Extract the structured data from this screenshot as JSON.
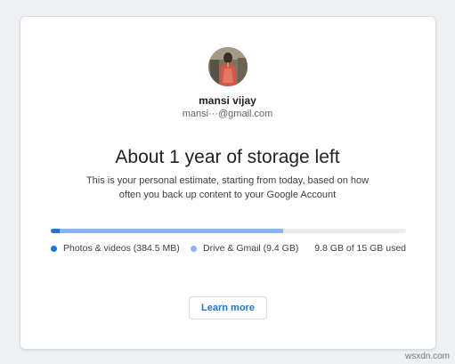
{
  "account": {
    "name": "mansi vijay",
    "email": "mansi···@gmail.com"
  },
  "estimate": {
    "headline": "About 1 year of storage left",
    "subtext_line1": "This is your personal estimate, starting from today, based on how",
    "subtext_line2": "often you back up content to your Google Account"
  },
  "storage": {
    "photos_label": "Photos & videos (384.5 MB)",
    "drive_label": "Drive & Gmail (9.4 GB)",
    "usage_text": "9.8 GB of 15 GB used",
    "photos_fraction": 0.025,
    "used_fraction": 0.653,
    "colors": {
      "photos": "#1a73e8",
      "drive": "#8ab4f8",
      "track": "#e8eaed"
    }
  },
  "actions": {
    "learn_more_label": "Learn more"
  },
  "watermark": "wsxdn.com"
}
